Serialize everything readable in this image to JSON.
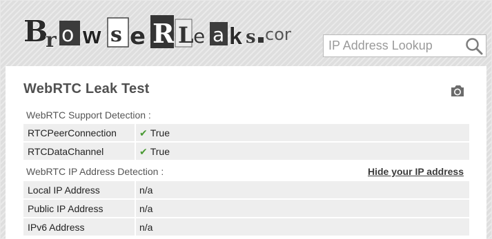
{
  "header": {
    "logo_text": "BrowseRLeaks.com",
    "search": {
      "placeholder": "IP Address Lookup",
      "value": ""
    }
  },
  "main": {
    "title": "WebRTC Leak Test",
    "support_section": {
      "label": "WebRTC Support Detection :",
      "rows": [
        {
          "key": "RTCPeerConnection",
          "value": "True"
        },
        {
          "key": "RTCDataChannel",
          "value": "True"
        }
      ]
    },
    "ip_section": {
      "label": "WebRTC IP Address Detection :",
      "link": "Hide your IP address",
      "rows": [
        {
          "key": "Local IP Address",
          "value": "n/a"
        },
        {
          "key": "Public IP Address",
          "value": "n/a"
        },
        {
          "key": "IPv6 Address",
          "value": "n/a"
        }
      ]
    }
  },
  "icons": {
    "search": "search-icon",
    "camera": "camera-icon",
    "check": "check-icon"
  },
  "colors": {
    "check": "#4a9a34",
    "row_bg": "#eeeeee",
    "title": "#505050"
  }
}
